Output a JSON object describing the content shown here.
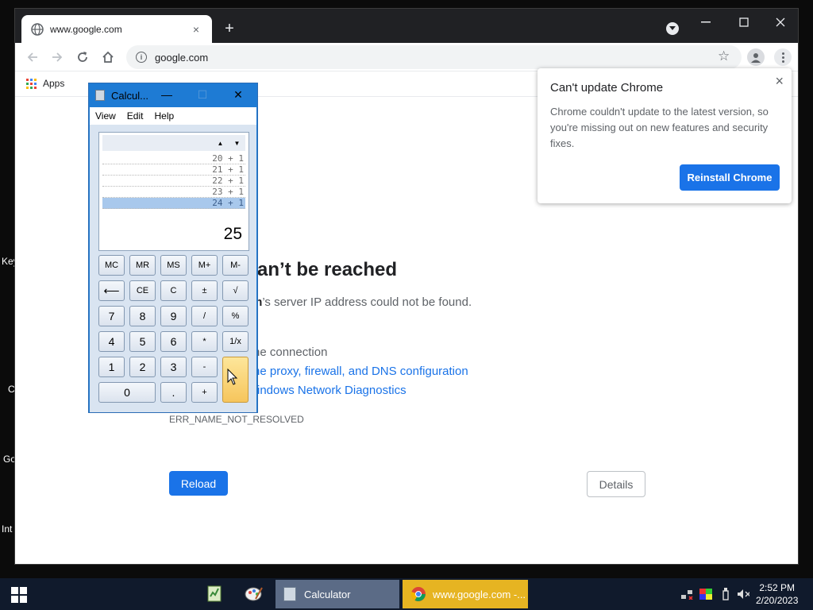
{
  "desktop": {
    "labels": [
      "Key",
      "C",
      "Go",
      "Int"
    ]
  },
  "browser": {
    "tab_title": "www.google.com",
    "tab_close": "×",
    "new_tab": "+",
    "url": "google.com",
    "bookmarks": {
      "apps_label": "Apps"
    },
    "error": {
      "title": "an’t be reached",
      "line1_bold": "m",
      "line1_rest": "’s server IP address could not be found.",
      "tip1": "he connection",
      "tip2": "he proxy, firewall, and DNS configuration",
      "tip3": "indows Network Diagnostics",
      "code": "ERR_NAME_NOT_RESOLVED",
      "reload_label": "Reload",
      "details_label": "Details"
    },
    "update_popup": {
      "title": "Can't update Chrome",
      "body": "Chrome couldn't update to the latest version, so you're missing out on new features and security fixes.",
      "button_label": "Reinstall Chrome",
      "close": "×"
    },
    "colors": {
      "accent": "#1a73e8",
      "frame": "#202124"
    }
  },
  "calculator": {
    "title": "Calcul...",
    "menu": [
      "View",
      "Edit",
      "Help"
    ],
    "history": [
      "20 + 1",
      "21 + 1",
      "22 + 1",
      "23 + 1",
      "24 + 1"
    ],
    "selected_history_index": 4,
    "display_value": "25",
    "keys": {
      "mc": "MC",
      "mr": "MR",
      "ms": "MS",
      "mplus": "M+",
      "mminus": "M-",
      "back": "⟵",
      "ce": "CE",
      "c": "C",
      "pm": "±",
      "sqrt": "√",
      "k7": "7",
      "k8": "8",
      "k9": "9",
      "div": "/",
      "pct": "%",
      "k4": "4",
      "k5": "5",
      "k6": "6",
      "mul": "*",
      "inv": "1/x",
      "k1": "1",
      "k2": "2",
      "k3": "3",
      "sub": "-",
      "k0": "0",
      "dot": ".",
      "add": "+",
      "eq": "="
    }
  },
  "taskbar": {
    "tasks": [
      {
        "label": "Calculator"
      },
      {
        "label": "www.google.com -..."
      }
    ],
    "time": "2:52 PM",
    "date": "2/20/2023"
  }
}
